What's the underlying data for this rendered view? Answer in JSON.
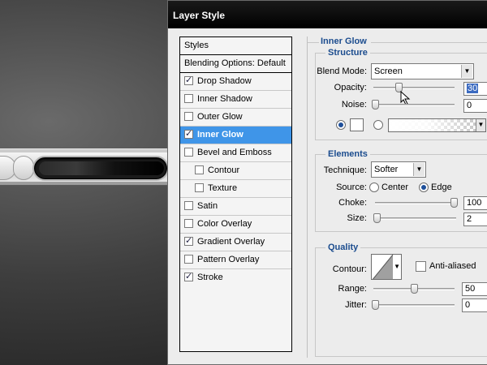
{
  "dialog": {
    "title": "Layer Style"
  },
  "styles_list": {
    "header": "Styles",
    "blending": "Blending Options: Default",
    "items": [
      {
        "label": "Drop Shadow",
        "checked": true
      },
      {
        "label": "Inner Shadow",
        "checked": false
      },
      {
        "label": "Outer Glow",
        "checked": false
      },
      {
        "label": "Inner Glow",
        "checked": true,
        "selected": true
      },
      {
        "label": "Bevel and Emboss",
        "checked": false
      },
      {
        "label": "Contour",
        "checked": false,
        "indent": true
      },
      {
        "label": "Texture",
        "checked": false,
        "indent": true
      },
      {
        "label": "Satin",
        "checked": false
      },
      {
        "label": "Color Overlay",
        "checked": false
      },
      {
        "label": "Gradient Overlay",
        "checked": true
      },
      {
        "label": "Pattern Overlay",
        "checked": false
      },
      {
        "label": "Stroke",
        "checked": true
      }
    ]
  },
  "inner_glow": {
    "title": "Inner Glow",
    "structure": {
      "title": "Structure",
      "blend_mode_label": "Blend Mode:",
      "blend_mode_value": "Screen",
      "opacity_label": "Opacity:",
      "opacity_value": "30",
      "noise_label": "Noise:",
      "noise_value": "0"
    },
    "elements": {
      "title": "Elements",
      "technique_label": "Technique:",
      "technique_value": "Softer",
      "source_label": "Source:",
      "source_center": "Center",
      "source_edge": "Edge",
      "choke_label": "Choke:",
      "choke_value": "100",
      "size_label": "Size:",
      "size_value": "2"
    },
    "quality": {
      "title": "Quality",
      "contour_label": "Contour:",
      "antialiased_label": "Anti-aliased",
      "range_label": "Range:",
      "range_value": "50",
      "jitter_label": "Jitter:",
      "jitter_value": "0"
    }
  },
  "colors": {
    "accent": "#1b4c8e",
    "selection": "#3f95e8",
    "titlebar": "#000000"
  }
}
